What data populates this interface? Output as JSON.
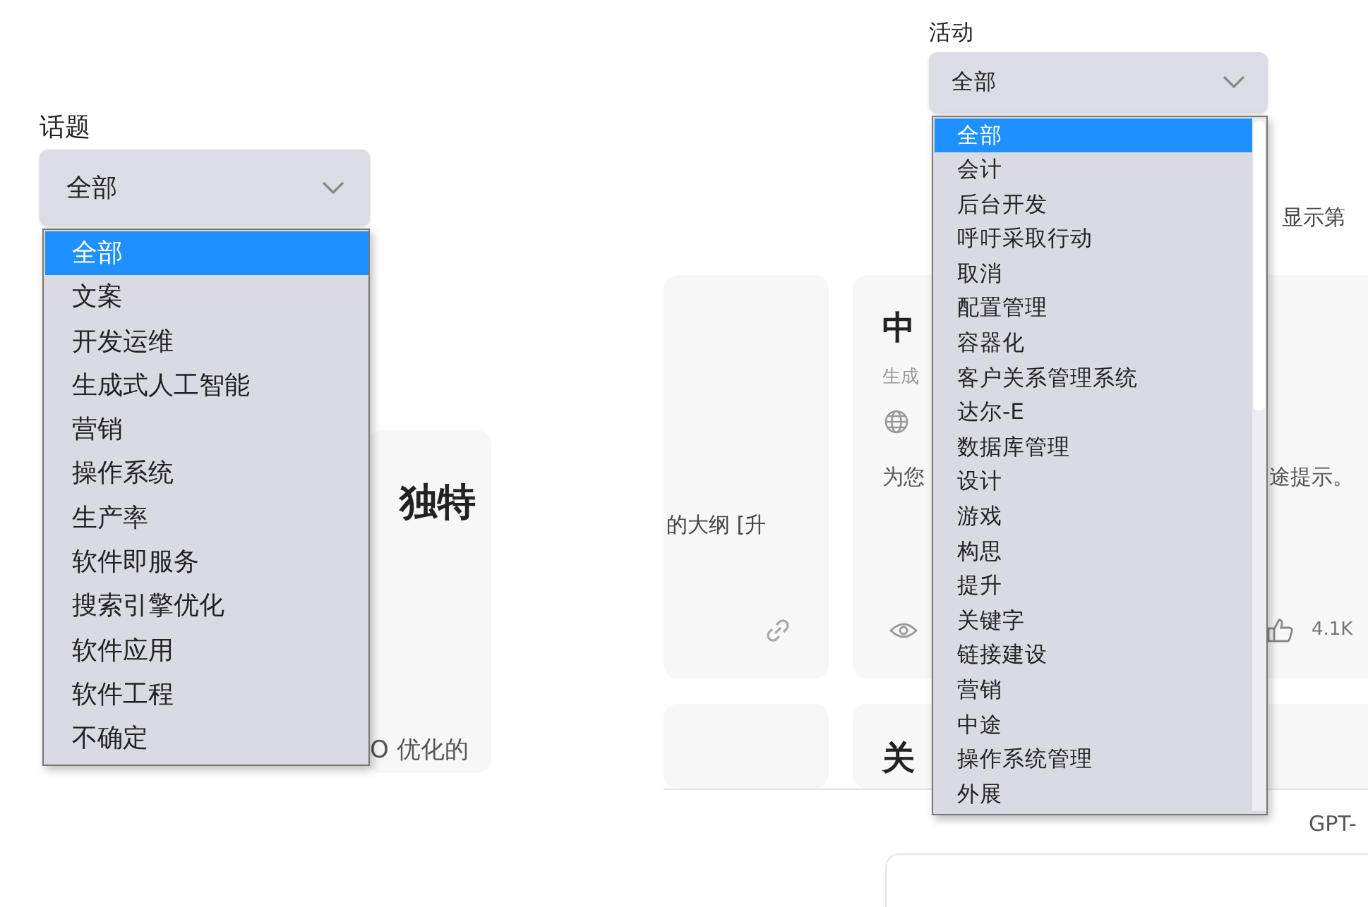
{
  "left_panel": {
    "filter": {
      "label": "话题",
      "value": "全部",
      "options": [
        {
          "label": "全部",
          "selected": true
        },
        {
          "label": "文案",
          "selected": false
        },
        {
          "label": "开发运维",
          "selected": false
        },
        {
          "label": "生成式人工智能",
          "selected": false
        },
        {
          "label": "营销",
          "selected": false
        },
        {
          "label": "操作系统",
          "selected": false
        },
        {
          "label": "生产率",
          "selected": false
        },
        {
          "label": "软件即服务",
          "selected": false
        },
        {
          "label": "搜索引擎优化",
          "selected": false
        },
        {
          "label": "软件应用",
          "selected": false
        },
        {
          "label": "软件工程",
          "selected": false
        },
        {
          "label": "不确定",
          "selected": false
        }
      ]
    },
    "card": {
      "title": "独特",
      "text": "O 优化的"
    }
  },
  "right_panel": {
    "filter": {
      "label": "活动",
      "value": "全部",
      "options": [
        {
          "label": "全部",
          "selected": true
        },
        {
          "label": "会计",
          "selected": false
        },
        {
          "label": "后台开发",
          "selected": false
        },
        {
          "label": "呼吁采取行动",
          "selected": false
        },
        {
          "label": "取消",
          "selected": false
        },
        {
          "label": "配置管理",
          "selected": false
        },
        {
          "label": "容器化",
          "selected": false
        },
        {
          "label": "客户关系管理系统",
          "selected": false
        },
        {
          "label": "达尔-E",
          "selected": false
        },
        {
          "label": "数据库管理",
          "selected": false
        },
        {
          "label": "设计",
          "selected": false
        },
        {
          "label": "游戏",
          "selected": false
        },
        {
          "label": "构思",
          "selected": false
        },
        {
          "label": "提升",
          "selected": false
        },
        {
          "label": "关键字",
          "selected": false
        },
        {
          "label": "链接建设",
          "selected": false
        },
        {
          "label": "营销",
          "selected": false
        },
        {
          "label": "中途",
          "selected": false
        },
        {
          "label": "操作系统管理",
          "selected": false
        },
        {
          "label": "外展",
          "selected": false
        }
      ]
    },
    "results_text": "显示第",
    "cards": [
      {
        "text": "的大纲 [升"
      },
      {
        "title": "中",
        "subtitle": "生成",
        "description_start": "为您",
        "description_end": "途提示。",
        "likes": "4.1K"
      },
      {
        "title": "关"
      }
    ],
    "model_label": "GPT-"
  }
}
